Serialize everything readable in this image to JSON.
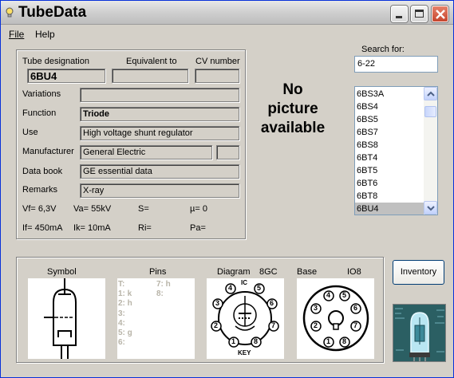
{
  "window": {
    "title": "TubeData"
  },
  "menu": {
    "file": "File",
    "help": "Help"
  },
  "labels": {
    "tube_designation": "Tube designation",
    "equivalent_to": "Equivalent to",
    "cv_number": "CV number",
    "variations": "Variations",
    "function": "Function",
    "use": "Use",
    "manufacturer": "Manufacturer",
    "data_book": "Data book",
    "remarks": "Remarks"
  },
  "values": {
    "tube_designation": "6BU4",
    "equivalent_to": "",
    "cv_number": "",
    "variations": "",
    "function": "Triode",
    "use": "High voltage shunt regulator",
    "manufacturer": "General Electric",
    "manufacturer_extra": "",
    "data_book": "GE essential data",
    "remarks": "X-ray"
  },
  "specs": {
    "vf": "Vf= 6,3V",
    "va": "Va= 55kV",
    "s": "S=",
    "mu": "µ=   0",
    "if": "If= 450mA",
    "ik": "Ik=  10mA",
    "ri": "Ri=",
    "pa": "Pa="
  },
  "picture": {
    "line1": "No",
    "line2": "picture",
    "line3": "available"
  },
  "search": {
    "label": "Search for:",
    "value": "6-22"
  },
  "tube_list": {
    "items": [
      "6BS3A",
      "6BS4",
      "6BS5",
      "6BS7",
      "6BS8",
      "6BT4",
      "6BT5",
      "6BT6",
      "6BT8",
      "6BU4"
    ],
    "selected": "6BU4"
  },
  "bottom": {
    "symbol": "Symbol",
    "pins": "Pins",
    "diagram": "Diagram",
    "diagram_code": "8GC",
    "base": "Base",
    "base_code": "IO8",
    "pins_list_left": [
      "T:",
      "1: k",
      "2: h",
      "3:",
      "4:",
      "5: g",
      "6:"
    ],
    "pins_list_right": [
      "7: h",
      "8:"
    ],
    "diagram_ic": "IC",
    "diagram_key": "KEY",
    "diagram_pins": [
      "1",
      "2",
      "3",
      "4",
      "5",
      "6",
      "7",
      "8"
    ],
    "base_pins": [
      "1",
      "2",
      "3",
      "4",
      "5",
      "6",
      "7",
      "8"
    ]
  },
  "buttons": {
    "inventory": "Inventory"
  }
}
